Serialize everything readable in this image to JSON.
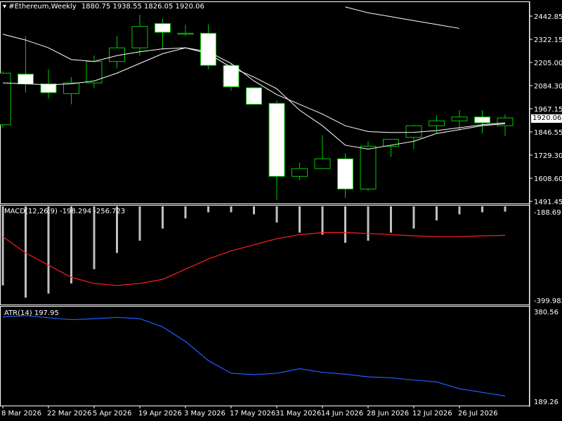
{
  "header": {
    "symbol": "#Ethereum,Weekly",
    "ohlc": "1880.75 1938.55 1826.05 1920.06",
    "macd_label": "MACD(12,26,9) -198.294 -256.723",
    "atr_label": "ATR(14) 197.95"
  },
  "price_axis": {
    "ticks": [
      "2442.85",
      "2322.15",
      "2205.00",
      "2084.30",
      "1967.15",
      "1846.55",
      "1729.30",
      "1608.60",
      "1491.45"
    ],
    "current": "1920.06"
  },
  "macd_axis": {
    "top": "-188.69",
    "bottom": "-399.982"
  },
  "atr_axis": {
    "top": "380.56",
    "bottom": "189.26"
  },
  "date_axis": [
    "8 Mar 2026",
    "22 Mar 2026",
    "5 Apr 2026",
    "19 Apr 2026",
    "3 May 2026",
    "17 May 2026",
    "31 May 2026",
    "14 Jun 2026",
    "28 Jun 2026",
    "12 Jul 2026",
    "26 Jul 2026"
  ],
  "colors": {
    "bull": "#00c800",
    "bear": "#ffffff",
    "ma": "#ffffff",
    "macd_signal": "#ff2020",
    "macd_hist": "#c0c0c0",
    "atr": "#1e5fff"
  },
  "chart_data": {
    "type": "candlestick",
    "price_range": [
      1491.45,
      2500
    ],
    "candles": [
      {
        "o": 1885,
        "h": 2160,
        "l": 1870,
        "c": 2150
      },
      {
        "o": 2145,
        "h": 2340,
        "l": 2050,
        "c": 2095
      },
      {
        "o": 2095,
        "h": 2170,
        "l": 2020,
        "c": 2050
      },
      {
        "o": 2045,
        "h": 2130,
        "l": 1990,
        "c": 2100
      },
      {
        "o": 2100,
        "h": 2240,
        "l": 2075,
        "c": 2210
      },
      {
        "o": 2210,
        "h": 2340,
        "l": 2175,
        "c": 2280
      },
      {
        "o": 2280,
        "h": 2450,
        "l": 2240,
        "c": 2390
      },
      {
        "o": 2405,
        "h": 2430,
        "l": 2270,
        "c": 2360
      },
      {
        "o": 2350,
        "h": 2400,
        "l": 2340,
        "c": 2355
      },
      {
        "o": 2355,
        "h": 2400,
        "l": 2170,
        "c": 2190
      },
      {
        "o": 2190,
        "h": 2200,
        "l": 2060,
        "c": 2080
      },
      {
        "o": 2075,
        "h": 2080,
        "l": 2000,
        "c": 1990
      },
      {
        "o": 1995,
        "h": 2010,
        "l": 1500,
        "c": 1620
      },
      {
        "o": 1620,
        "h": 1690,
        "l": 1600,
        "c": 1660
      },
      {
        "o": 1660,
        "h": 1830,
        "l": 1660,
        "c": 1710
      },
      {
        "o": 1710,
        "h": 1740,
        "l": 1510,
        "c": 1555
      },
      {
        "o": 1555,
        "h": 1800,
        "l": 1545,
        "c": 1775
      },
      {
        "o": 1775,
        "h": 1810,
        "l": 1720,
        "c": 1810
      },
      {
        "o": 1820,
        "h": 1885,
        "l": 1760,
        "c": 1880
      },
      {
        "o": 1880,
        "h": 1935,
        "l": 1840,
        "c": 1905
      },
      {
        "o": 1905,
        "h": 1960,
        "l": 1855,
        "c": 1925
      },
      {
        "o": 1925,
        "h": 1960,
        "l": 1840,
        "c": 1895
      },
      {
        "o": 1880,
        "h": 1938.55,
        "l": 1826.05,
        "c": 1920.06
      }
    ],
    "ma_fast": [
      2100,
      2095,
      2090,
      2095,
      2110,
      2150,
      2200,
      2250,
      2280,
      2250,
      2180,
      2130,
      2070,
      1960,
      1880,
      1780,
      1760,
      1780,
      1800,
      1840,
      1860,
      1880,
      1890
    ],
    "ma_slow": [
      2350,
      2320,
      2280,
      2220,
      2210,
      2240,
      2260,
      2275,
      2280,
      2260,
      2200,
      2110,
      2040,
      1990,
      1940,
      1880,
      1850,
      1845,
      1846,
      1855,
      1870,
      1885,
      1895
    ],
    "ma_slow_top": [
      2490,
      2460,
      2440,
      2420,
      2400,
      2380
    ],
    "macd_range": [
      -420,
      -188.69
    ],
    "macd_hist": [
      -380,
      -410,
      -400,
      -375,
      -340,
      -300,
      -270,
      -240,
      -215,
      -200,
      -200,
      -205,
      -225,
      -250,
      -255,
      -275,
      -270,
      -250,
      -240,
      -220,
      -205,
      -200,
      -198.294
    ],
    "macd_signal": [
      -260,
      -300,
      -330,
      -360,
      -375,
      -380,
      -375,
      -365,
      -340,
      -315,
      -295,
      -280,
      -265,
      -255,
      -250,
      -250,
      -252,
      -255,
      -258,
      -260,
      -260,
      -258,
      -256.723
    ],
    "atr_range": [
      180,
      390
    ],
    "atr": [
      372,
      375,
      370,
      366,
      368,
      371,
      368,
      350,
      318,
      276,
      248,
      245,
      248,
      258,
      250,
      246,
      240,
      238,
      233,
      229,
      214,
      206,
      197.95
    ]
  }
}
